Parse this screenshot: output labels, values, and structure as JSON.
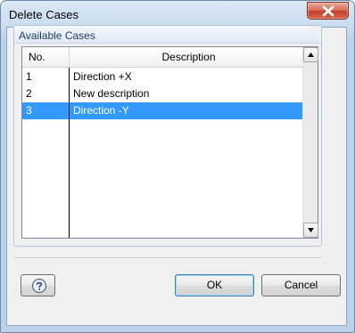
{
  "window": {
    "title": "Delete Cases",
    "close_icon": "close-icon"
  },
  "group": {
    "title": "Available Cases"
  },
  "list": {
    "columns": [
      "No.",
      "Description"
    ],
    "rows": [
      {
        "no": "1",
        "description": "Direction +X",
        "selected": false
      },
      {
        "no": "2",
        "description": "New description",
        "selected": false
      },
      {
        "no": "3",
        "description": "Direction -Y",
        "selected": true
      }
    ]
  },
  "buttons": {
    "help_icon": "help-icon",
    "ok_label": "OK",
    "cancel_label": "Cancel"
  },
  "colors": {
    "selection": "#3399ff",
    "close_button": "#c4402b",
    "group_title": "#1e3e66"
  }
}
